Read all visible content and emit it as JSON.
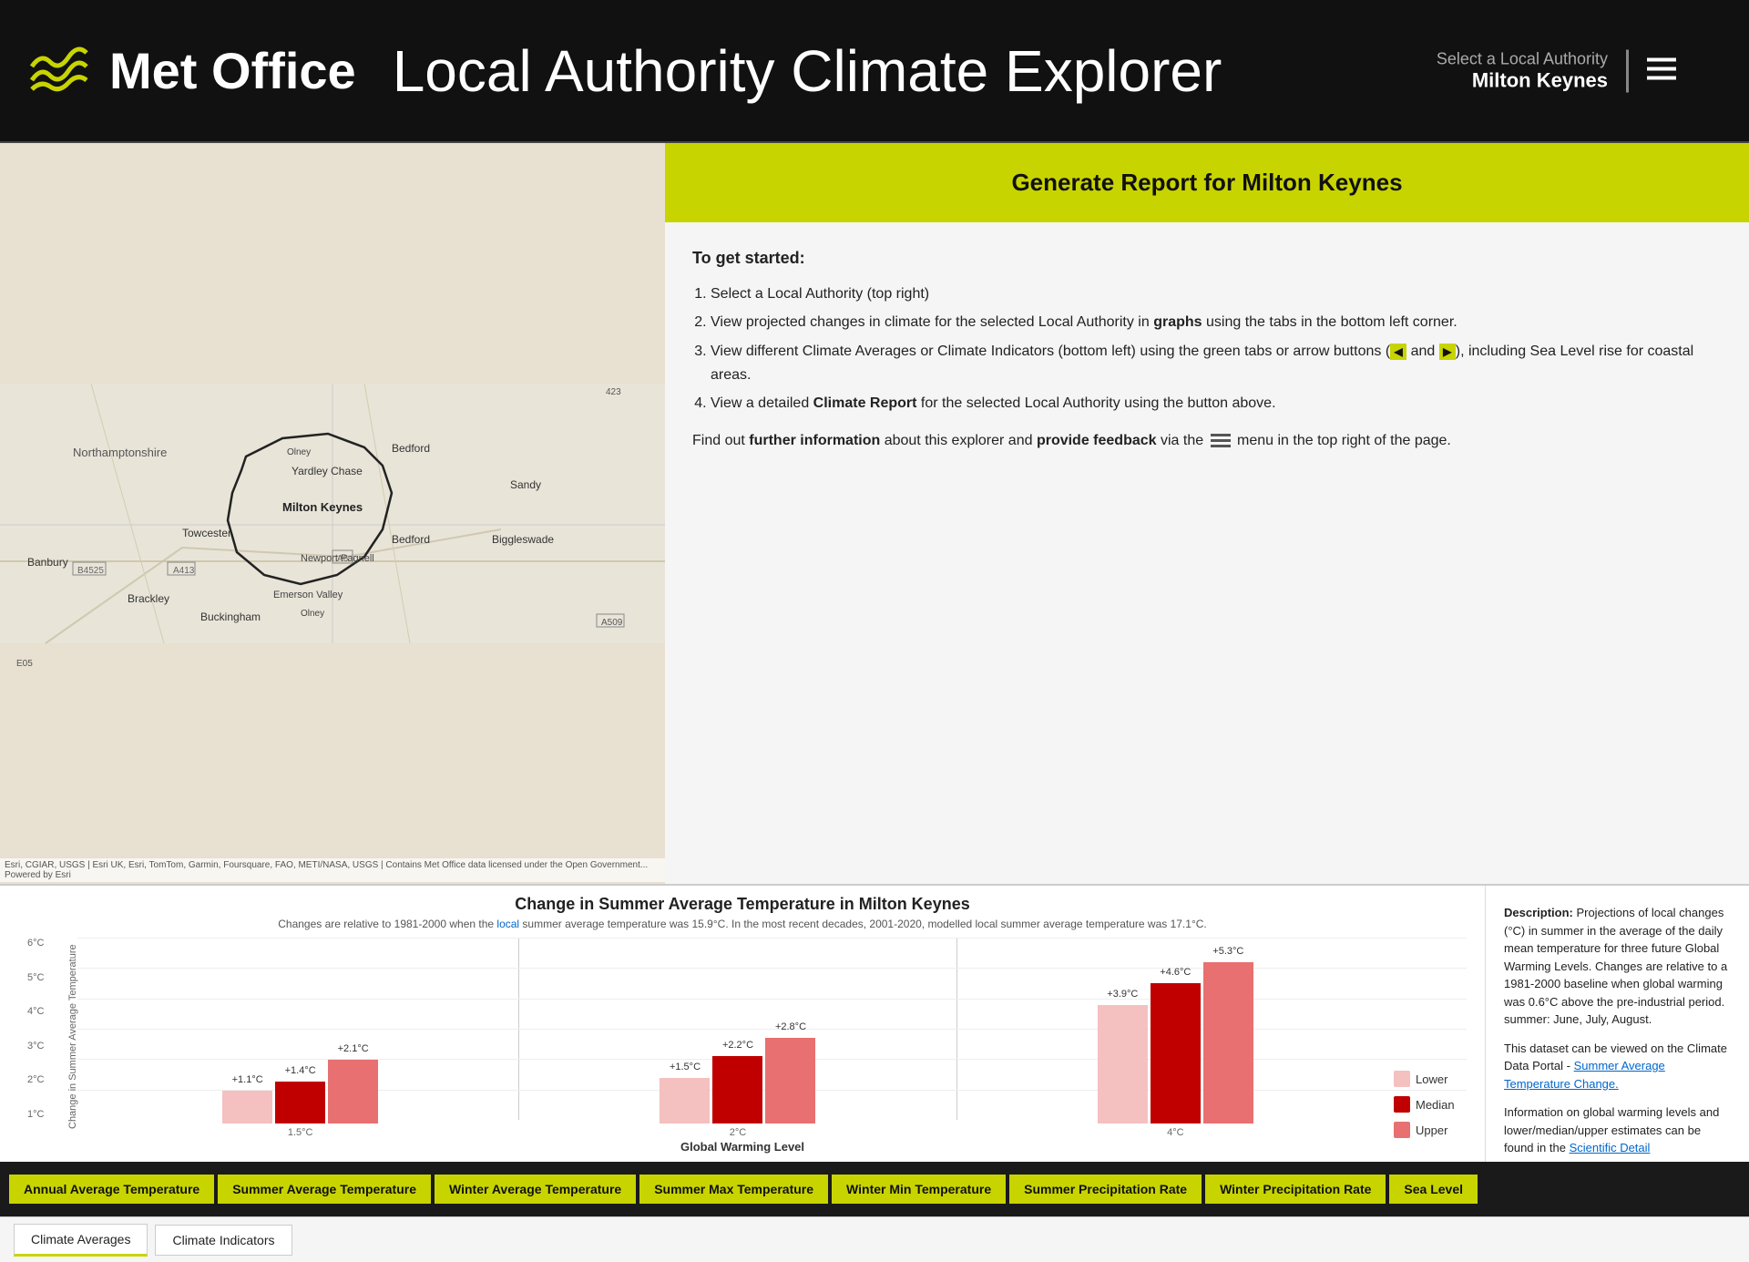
{
  "header": {
    "logo_text": "Met Office",
    "title": "Local Authority Climate Explorer",
    "select_label": "Select a Local Authority",
    "select_value": "Milton Keynes"
  },
  "info_panel": {
    "generate_report_label": "Generate Report for Milton Keynes",
    "get_started": "To get started:",
    "steps": [
      "Select a Local Authority (top right)",
      "View projected changes in climate for the selected Local Authority in graphs using the tabs in the bottom left corner.",
      "View different Climate Averages or Climate Indicators (bottom left) using the green tabs or arrow buttons (◀ and ▶), including Sea Level rise for coastal areas.",
      "View a detailed Climate Report for the selected Local Authority using the button above."
    ],
    "footer_text": "Find out further information about this explorer and provide feedback via the",
    "footer_suffix": "menu in the top right of the page."
  },
  "chart": {
    "title": "Change in Summer Average Temperature in Milton Keynes",
    "subtitle": "Changes are relative to 1981-2000 when the local summer average temperature was 15.9°C. In the most recent decades, 2001-2020, modelled local summer average temperature was 17.1°C.",
    "y_axis_title": "Change in Summer Average Temperature",
    "x_axis_title": "Global Warming Level",
    "y_labels": [
      "6°C",
      "5°C",
      "4°C",
      "3°C",
      "2°C",
      "1°C"
    ],
    "groups": [
      {
        "x_label": "1.5°C",
        "bars": [
          {
            "type": "lower",
            "value": 1.1,
            "label": "+1.1°C",
            "height_pct": 18
          },
          {
            "type": "median",
            "value": 1.4,
            "label": "+1.4°C",
            "height_pct": 23
          },
          {
            "type": "upper",
            "value": 2.1,
            "label": "+2.1°C",
            "height_pct": 35
          }
        ]
      },
      {
        "x_label": "2°C",
        "bars": [
          {
            "type": "lower",
            "value": 1.5,
            "label": "+1.5°C",
            "height_pct": 25
          },
          {
            "type": "median",
            "value": 2.2,
            "label": "+2.2°C",
            "height_pct": 37
          },
          {
            "type": "upper",
            "value": 2.8,
            "label": "+2.8°C",
            "height_pct": 47
          }
        ]
      },
      {
        "x_label": "4°C",
        "bars": [
          {
            "type": "lower",
            "value": 3.9,
            "label": "+3.9°C",
            "height_pct": 65
          },
          {
            "type": "median",
            "value": 4.6,
            "label": "+4.6°C",
            "height_pct": 77
          },
          {
            "type": "upper",
            "value": 5.3,
            "label": "+5.3°C",
            "height_pct": 88
          }
        ]
      }
    ],
    "legend": [
      {
        "label": "Lower",
        "class": "legend-lower"
      },
      {
        "label": "Median",
        "class": "legend-median"
      },
      {
        "label": "Upper",
        "class": "legend-upper"
      }
    ]
  },
  "description": {
    "title": "Description:",
    "text1": "Projections of local changes (°C) in summer in the average of the daily mean temperature for three future Global Warming Levels. Changes are relative to a 1981-2000 baseline when global warming was 0.6°C above the pre-industrial period. summer: June, July, August.",
    "text2": "This dataset can be viewed on the Climate Data Portal -",
    "link1": "Summer Average Temperature Change.",
    "text3": "Information on global warming levels and lower/median/upper estimates can be found in the",
    "link2": "Scientific Detail"
  },
  "bottom_tabs": [
    {
      "label": "Annual Average Temperature",
      "active": false
    },
    {
      "label": "Summer Average Temperature",
      "active": true
    },
    {
      "label": "Winter Average Temperature",
      "active": false
    },
    {
      "label": "Summer Max Temperature",
      "active": false
    },
    {
      "label": "Winter Min Temperature",
      "active": false
    },
    {
      "label": "Summer Precipitation Rate",
      "active": false
    },
    {
      "label": "Winter Precipitation Rate",
      "active": false
    },
    {
      "label": "Sea Level",
      "active": false
    }
  ],
  "second_tabs": [
    {
      "label": "Climate Averages",
      "active": true
    },
    {
      "label": "Climate Indicators",
      "active": false
    }
  ],
  "map": {
    "attribution": "Esri, CGIAR, USGS | Esri UK, Esri, TomTom, Garmin, Foursquare, FAO, METI/NASA, USGS | Contains Met Office data licensed under the Open Government... Powered by Esri"
  }
}
